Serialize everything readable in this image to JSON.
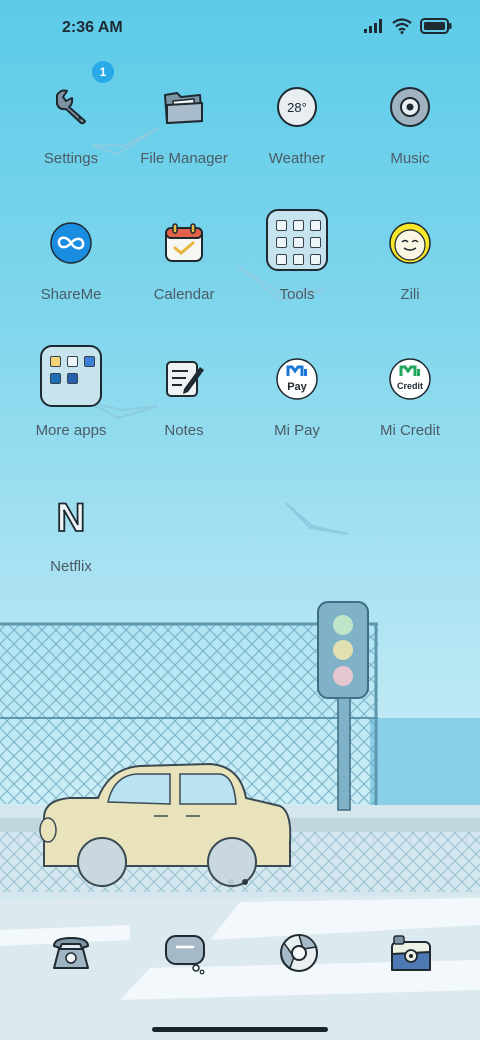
{
  "status_bar": {
    "time": "2:36 AM",
    "icons": [
      "signal-icon",
      "wifi-icon",
      "battery-icon"
    ]
  },
  "home_screen": {
    "apps": [
      {
        "label": "Settings",
        "icon": "wrench-icon",
        "badge": "1"
      },
      {
        "label": "File Manager",
        "icon": "folder-icon"
      },
      {
        "label": "Weather",
        "icon": "weather-icon",
        "icon_text": "28°"
      },
      {
        "label": "Music",
        "icon": "music-disc-icon"
      },
      {
        "label": "ShareMe",
        "icon": "shareme-icon"
      },
      {
        "label": "Calendar",
        "icon": "calendar-icon"
      },
      {
        "label": "Tools",
        "icon": "tools-folder-icon"
      },
      {
        "label": "Zili",
        "icon": "zili-face-icon"
      },
      {
        "label": "More apps",
        "icon": "more-apps-folder-icon"
      },
      {
        "label": "Notes",
        "icon": "notes-icon"
      },
      {
        "label": "Mi Pay",
        "icon": "mi-pay-icon",
        "icon_text": "Pay"
      },
      {
        "label": "Mi Credit",
        "icon": "mi-credit-icon",
        "icon_text": "Credit"
      },
      {
        "label": "Netflix",
        "icon": "netflix-icon",
        "icon_text": "N"
      }
    ]
  },
  "page_indicator": {
    "pages": 2,
    "active_page": 2
  },
  "dock": {
    "items": [
      {
        "icon": "phone-icon"
      },
      {
        "icon": "messages-icon"
      },
      {
        "icon": "browser-icon"
      },
      {
        "icon": "camera-icon"
      }
    ]
  },
  "colors": {
    "badge": "#28a9e8",
    "label_text": "#4b5c66",
    "outline": "#1e2930"
  }
}
